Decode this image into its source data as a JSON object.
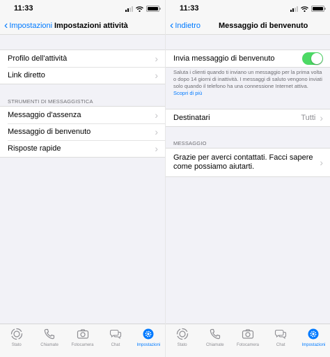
{
  "status_time": "11:33",
  "colors": {
    "accent": "#007aff",
    "toggle_on": "#4cd964",
    "background": "#f2f2f7"
  },
  "left_screen": {
    "nav": {
      "back_label": "Impostazioni",
      "title": "Impostazioni attività"
    },
    "group1": [
      {
        "label": "Profilo dell'attività"
      },
      {
        "label": "Link diretto"
      }
    ],
    "section_header": "STRUMENTI DI MESSAGGISTICA",
    "group2": [
      {
        "label": "Messaggio d'assenza"
      },
      {
        "label": "Messaggio di benvenuto"
      },
      {
        "label": "Risposte rapide"
      }
    ]
  },
  "right_screen": {
    "nav": {
      "back_label": "Indietro",
      "title": "Messaggio di benvenuto"
    },
    "toggle_row": {
      "label": "Invia messaggio di benvenuto",
      "enabled": true
    },
    "footnote": "Saluta i clienti quando ti inviano un messaggio per la prima volta o dopo 14 giorni di inattività. I messaggi di saluto vengono inviati solo quando il telefono ha una connessione Internet attiva.",
    "footnote_link": "Scopri di più",
    "recipients": {
      "label": "Destinatari",
      "value": "Tutti"
    },
    "section_header": "MESSAGGIO",
    "message_text": "Grazie per averci contattati. Facci sapere come possiamo aiutarti."
  },
  "tabbar": [
    {
      "label": "Stato",
      "icon": "status-icon",
      "active": false
    },
    {
      "label": "Chiamate",
      "icon": "phone-icon",
      "active": false
    },
    {
      "label": "Fotocamera",
      "icon": "camera-icon",
      "active": false
    },
    {
      "label": "Chat",
      "icon": "chat-icon",
      "active": false
    },
    {
      "label": "Impostazioni",
      "icon": "settings-icon",
      "active": true
    }
  ]
}
